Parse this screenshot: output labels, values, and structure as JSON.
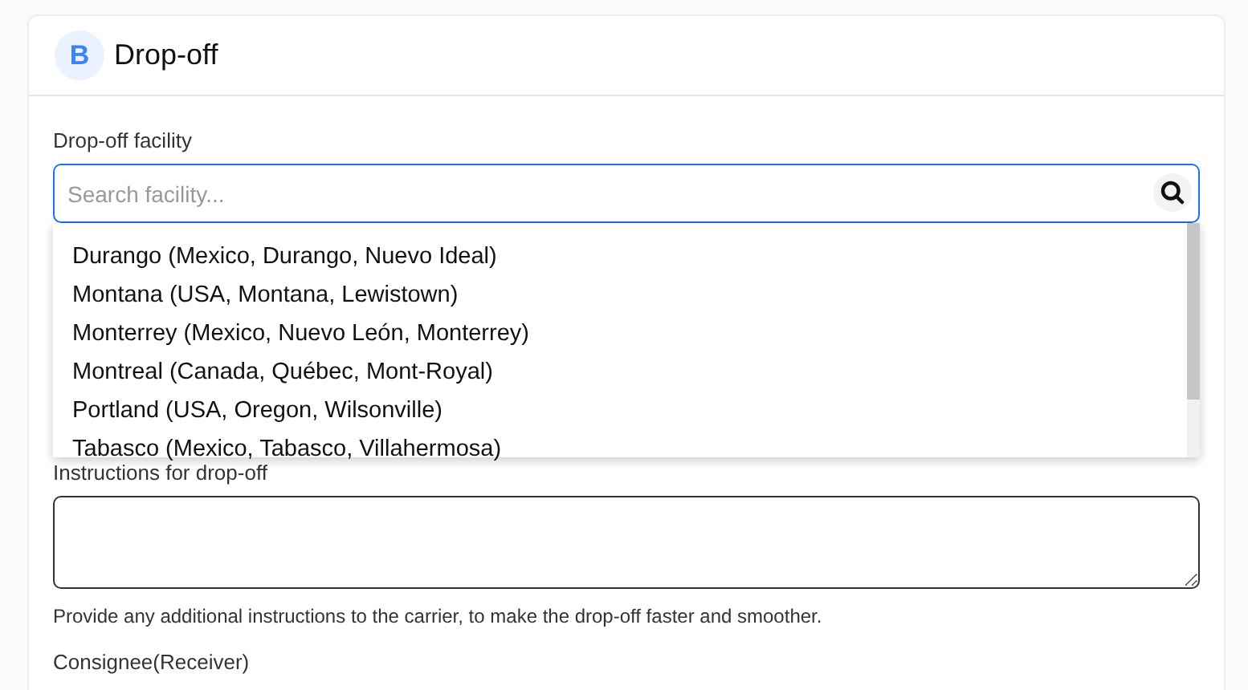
{
  "section": {
    "badge": "B",
    "title": "Drop-off"
  },
  "facility": {
    "label": "Drop-off facility",
    "placeholder": "Search facility...",
    "focused": true,
    "options": [
      {
        "label": "Durango (Mexico, Durango, Nuevo Ideal)"
      },
      {
        "label": "Montana (USA, Montana, Lewistown)"
      },
      {
        "label": "Monterrey (Mexico, Nuevo León, Monterrey)"
      },
      {
        "label": "Montreal (Canada, Québec, Mont-Royal)"
      },
      {
        "label": "Portland (USA, Oregon, Wilsonville)"
      },
      {
        "label": "Tabasco (Mexico, Tabasco, Villahermosa)"
      }
    ]
  },
  "instructions": {
    "label": "Instructions for drop-off",
    "help": "Provide any additional instructions to the carrier, to make the drop-off faster and smoother."
  },
  "next_section": {
    "label": "Consignee(Receiver)"
  }
}
